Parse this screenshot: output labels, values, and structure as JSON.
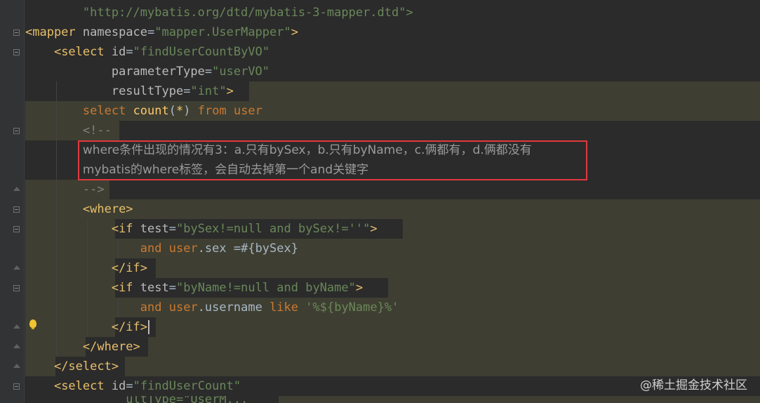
{
  "code": {
    "l1": {
      "doctype": "\"http://mybatis.org/dtd/mybatis-3-mapper.dtd\">"
    },
    "l2": {
      "open": "<mapper",
      "attr": "namespace",
      "value": "\"mapper.UserMapper\"",
      "close": ">"
    },
    "l3": {
      "open": "<select",
      "attr": "id",
      "value": "\"findUserCountByVO\""
    },
    "l4": {
      "attr": "parameterType",
      "value": "\"userVO\""
    },
    "l5": {
      "attr": "resultType",
      "value": "\"int\"",
      "close": ">"
    },
    "l6": {
      "kw_select": "select",
      "fn": "count",
      "paren_open": "(",
      "star": "*",
      "paren_close": ")",
      "kw_from": "from",
      "kw_table": "user"
    },
    "l7": {
      "comment_open": "<!--"
    },
    "l8": {
      "comment": "where条件出现的情况有3：a.只有bySex，b.只有byName，c.俩都有，d.俩都没有"
    },
    "l9": {
      "comment": "mybatis的where标签，会自动去掉第一个and关键字"
    },
    "l10": {
      "comment_close": "-->"
    },
    "l11": {
      "tag": "<where>"
    },
    "l12": {
      "open": "<if",
      "attr": "test",
      "value": "\"bySex!=null and bySex!=''\"",
      "close": ">"
    },
    "l13": {
      "kw_and": "and",
      "table": "user",
      "rest": ".sex =#{bySex}"
    },
    "l14": {
      "tag": "</if>"
    },
    "l15": {
      "open": "<if",
      "attr": "test",
      "value": "\"byName!=null and byName\"",
      "close": ">"
    },
    "l16": {
      "kw_and": "and",
      "table": "user",
      "field": ".username",
      "kw_like": "like",
      "value": "'%${byName}%'"
    },
    "l17": {
      "tag": "</if>"
    },
    "l18": {
      "tag": "</where>"
    },
    "l19": {
      "tag": "</select>"
    },
    "l20": {
      "open": "<select",
      "attr": "id",
      "value": "\"findUserCount\""
    },
    "l21": {
      "partial": "ultType=\"UserM..."
    }
  },
  "watermark": "@稀土掘金技术社区",
  "colors": {
    "background": "#2b2b2b",
    "tag": "#e8bf6a",
    "attribute_value": "#6a8759",
    "keyword": "#cc7832",
    "annotation_box": "#e0393e"
  },
  "icons": {
    "gutter_hint": "lightbulb-icon"
  }
}
